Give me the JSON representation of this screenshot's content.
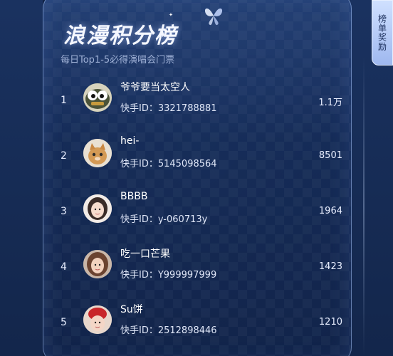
{
  "header": {
    "title": "浪漫积分榜",
    "subtitle": "每日Top1-5必得演唱会门票"
  },
  "reward_tab": {
    "label": "榜单奖励"
  },
  "ranking": [
    {
      "rank": "1",
      "name": "爷爷要当太空人",
      "uid_label": "快手ID：3321788881",
      "score": "1.1万",
      "avatar": "cartoon-eyes-avatar"
    },
    {
      "rank": "2",
      "name": "hei-",
      "uid_label": "快手ID：5145098564",
      "score": "8501",
      "avatar": "cat-avatar"
    },
    {
      "rank": "3",
      "name": "BBBB",
      "uid_label": "快手ID：y-060713y",
      "score": "1964",
      "avatar": "girl-avatar"
    },
    {
      "rank": "4",
      "name": "吃一口芒果",
      "uid_label": "快手ID：Y999997999",
      "score": "1423",
      "avatar": "girl-avatar"
    },
    {
      "rank": "5",
      "name": "Su饼",
      "uid_label": "快手ID：2512898446",
      "score": "1210",
      "avatar": "girl-red-hat-avatar"
    }
  ],
  "colors": {
    "background": "#162c55",
    "panel_border": "#aac8ff",
    "tab_bg": "#cfe0ff"
  }
}
